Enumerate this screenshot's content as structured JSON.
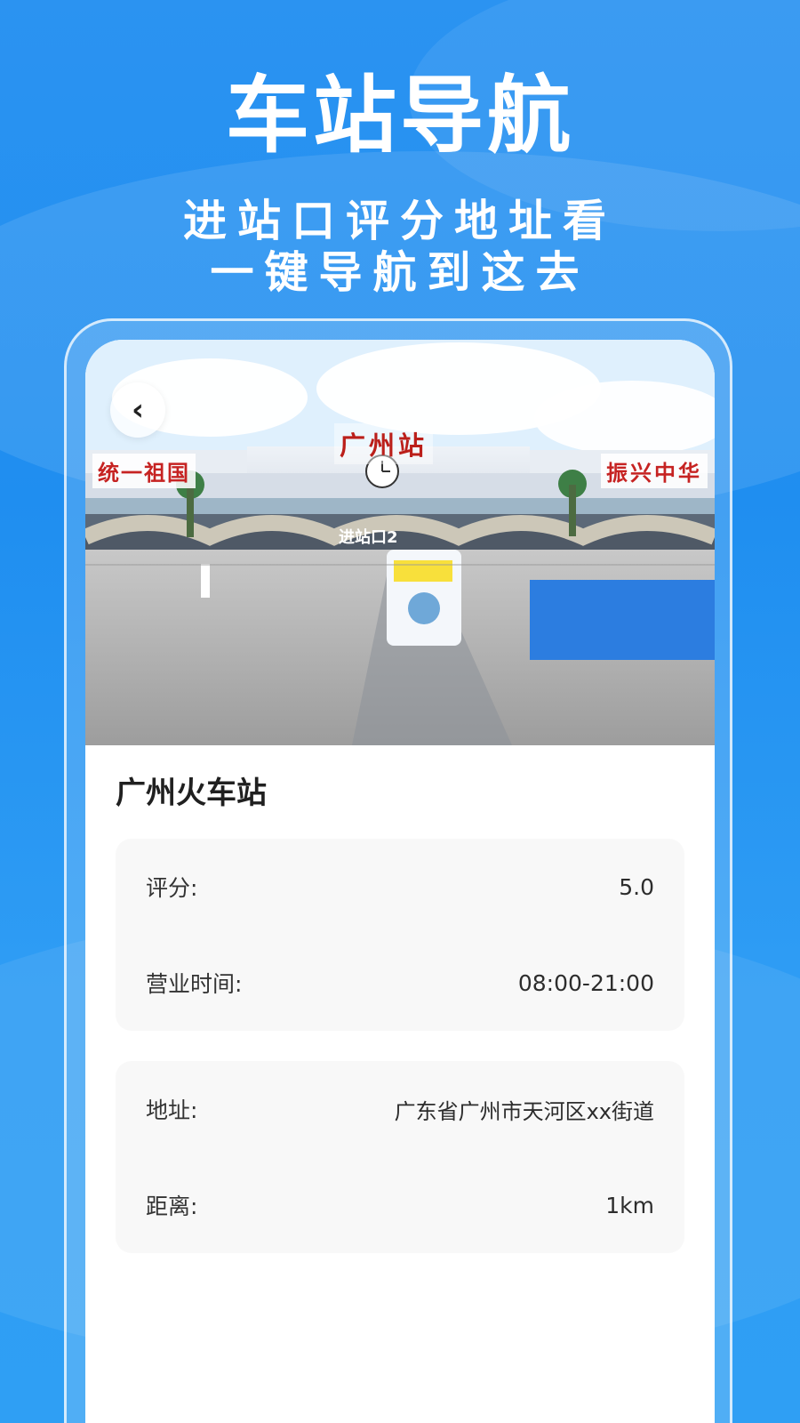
{
  "hero": {
    "title": "车站导航",
    "subtitle_line_1": "进站口评分地址看",
    "subtitle_line_2": "一键导航到这去"
  },
  "photo": {
    "back_icon": "chevron-left-icon",
    "top_sign": "广州站",
    "left_banner": "统一祖国",
    "right_banner": "振兴中华",
    "gate_text": "进站口2"
  },
  "details": {
    "station_name": "广州火车站",
    "rating_label": "评分:",
    "rating_value": "5.0",
    "hours_label": "营业时间:",
    "hours_value": "08:00-21:00",
    "address_label": "地址:",
    "address_value": "广东省广州市天河区xx街道",
    "distance_label": "距离:",
    "distance_value": "1km"
  },
  "colors": {
    "brand_blue": "#1f8ef0",
    "text_dark": "#202020",
    "panel_gray": "#f8f8f8",
    "accent_red": "#c62322"
  }
}
